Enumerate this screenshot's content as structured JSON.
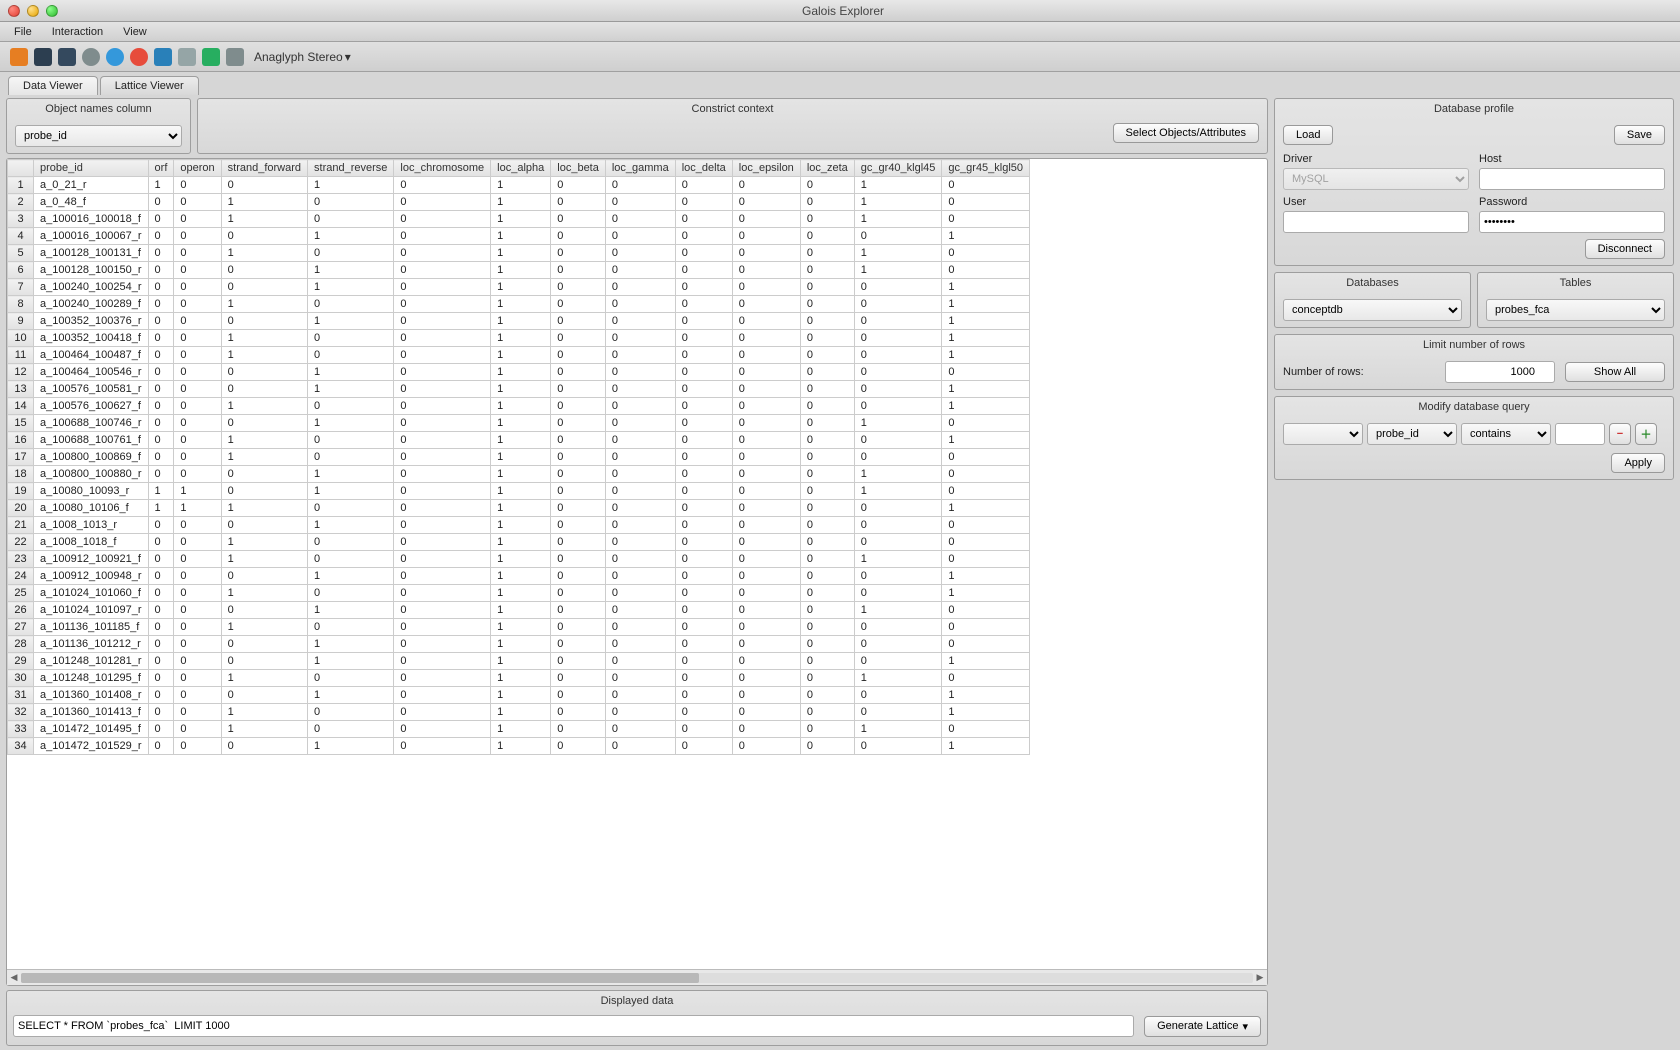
{
  "window": {
    "title": "Galois Explorer"
  },
  "menu": {
    "file": "File",
    "interaction": "Interaction",
    "view": "View"
  },
  "toolbar": {
    "stereo": "Anaglyph Stereo"
  },
  "tabs": {
    "data_viewer": "Data Viewer",
    "lattice_viewer": "Lattice Viewer"
  },
  "obj_col": {
    "header": "Object names column",
    "value": "probe_id"
  },
  "constrict": {
    "header": "Constrict context",
    "select_btn": "Select Objects/Attributes"
  },
  "columns": [
    "probe_id",
    "orf",
    "operon",
    "strand_forward",
    "strand_reverse",
    "loc_chromosome",
    "loc_alpha",
    "loc_beta",
    "loc_gamma",
    "loc_delta",
    "loc_epsilon",
    "loc_zeta",
    "gc_gr40_klgl45",
    "gc_gr45_klgl50"
  ],
  "rows": [
    {
      "n": 1,
      "v": [
        "a_0_21_r",
        "1",
        "0",
        "0",
        "1",
        "0",
        "1",
        "0",
        "0",
        "0",
        "0",
        "0",
        "1",
        "0"
      ]
    },
    {
      "n": 2,
      "v": [
        "a_0_48_f",
        "0",
        "0",
        "1",
        "0",
        "0",
        "1",
        "0",
        "0",
        "0",
        "0",
        "0",
        "1",
        "0"
      ]
    },
    {
      "n": 3,
      "v": [
        "a_100016_100018_f",
        "0",
        "0",
        "1",
        "0",
        "0",
        "1",
        "0",
        "0",
        "0",
        "0",
        "0",
        "1",
        "0"
      ]
    },
    {
      "n": 4,
      "v": [
        "a_100016_100067_r",
        "0",
        "0",
        "0",
        "1",
        "0",
        "1",
        "0",
        "0",
        "0",
        "0",
        "0",
        "0",
        "1"
      ]
    },
    {
      "n": 5,
      "v": [
        "a_100128_100131_f",
        "0",
        "0",
        "1",
        "0",
        "0",
        "1",
        "0",
        "0",
        "0",
        "0",
        "0",
        "1",
        "0"
      ]
    },
    {
      "n": 6,
      "v": [
        "a_100128_100150_r",
        "0",
        "0",
        "0",
        "1",
        "0",
        "1",
        "0",
        "0",
        "0",
        "0",
        "0",
        "1",
        "0"
      ]
    },
    {
      "n": 7,
      "v": [
        "a_100240_100254_r",
        "0",
        "0",
        "0",
        "1",
        "0",
        "1",
        "0",
        "0",
        "0",
        "0",
        "0",
        "0",
        "1"
      ]
    },
    {
      "n": 8,
      "v": [
        "a_100240_100289_f",
        "0",
        "0",
        "1",
        "0",
        "0",
        "1",
        "0",
        "0",
        "0",
        "0",
        "0",
        "0",
        "1"
      ]
    },
    {
      "n": 9,
      "v": [
        "a_100352_100376_r",
        "0",
        "0",
        "0",
        "1",
        "0",
        "1",
        "0",
        "0",
        "0",
        "0",
        "0",
        "0",
        "1"
      ]
    },
    {
      "n": 10,
      "v": [
        "a_100352_100418_f",
        "0",
        "0",
        "1",
        "0",
        "0",
        "1",
        "0",
        "0",
        "0",
        "0",
        "0",
        "0",
        "1"
      ]
    },
    {
      "n": 11,
      "v": [
        "a_100464_100487_f",
        "0",
        "0",
        "1",
        "0",
        "0",
        "1",
        "0",
        "0",
        "0",
        "0",
        "0",
        "0",
        "1"
      ]
    },
    {
      "n": 12,
      "v": [
        "a_100464_100546_r",
        "0",
        "0",
        "0",
        "1",
        "0",
        "1",
        "0",
        "0",
        "0",
        "0",
        "0",
        "0",
        "0"
      ]
    },
    {
      "n": 13,
      "v": [
        "a_100576_100581_r",
        "0",
        "0",
        "0",
        "1",
        "0",
        "1",
        "0",
        "0",
        "0",
        "0",
        "0",
        "0",
        "1"
      ]
    },
    {
      "n": 14,
      "v": [
        "a_100576_100627_f",
        "0",
        "0",
        "1",
        "0",
        "0",
        "1",
        "0",
        "0",
        "0",
        "0",
        "0",
        "0",
        "1"
      ]
    },
    {
      "n": 15,
      "v": [
        "a_100688_100746_r",
        "0",
        "0",
        "0",
        "1",
        "0",
        "1",
        "0",
        "0",
        "0",
        "0",
        "0",
        "1",
        "0"
      ]
    },
    {
      "n": 16,
      "v": [
        "a_100688_100761_f",
        "0",
        "0",
        "1",
        "0",
        "0",
        "1",
        "0",
        "0",
        "0",
        "0",
        "0",
        "0",
        "1"
      ]
    },
    {
      "n": 17,
      "v": [
        "a_100800_100869_f",
        "0",
        "0",
        "1",
        "0",
        "0",
        "1",
        "0",
        "0",
        "0",
        "0",
        "0",
        "0",
        "0"
      ]
    },
    {
      "n": 18,
      "v": [
        "a_100800_100880_r",
        "0",
        "0",
        "0",
        "1",
        "0",
        "1",
        "0",
        "0",
        "0",
        "0",
        "0",
        "1",
        "0"
      ]
    },
    {
      "n": 19,
      "v": [
        "a_10080_10093_r",
        "1",
        "1",
        "0",
        "1",
        "0",
        "1",
        "0",
        "0",
        "0",
        "0",
        "0",
        "1",
        "0"
      ]
    },
    {
      "n": 20,
      "v": [
        "a_10080_10106_f",
        "1",
        "1",
        "1",
        "0",
        "0",
        "1",
        "0",
        "0",
        "0",
        "0",
        "0",
        "0",
        "1"
      ]
    },
    {
      "n": 21,
      "v": [
        "a_1008_1013_r",
        "0",
        "0",
        "0",
        "1",
        "0",
        "1",
        "0",
        "0",
        "0",
        "0",
        "0",
        "0",
        "0"
      ]
    },
    {
      "n": 22,
      "v": [
        "a_1008_1018_f",
        "0",
        "0",
        "1",
        "0",
        "0",
        "1",
        "0",
        "0",
        "0",
        "0",
        "0",
        "0",
        "0"
      ]
    },
    {
      "n": 23,
      "v": [
        "a_100912_100921_f",
        "0",
        "0",
        "1",
        "0",
        "0",
        "1",
        "0",
        "0",
        "0",
        "0",
        "0",
        "1",
        "0"
      ]
    },
    {
      "n": 24,
      "v": [
        "a_100912_100948_r",
        "0",
        "0",
        "0",
        "1",
        "0",
        "1",
        "0",
        "0",
        "0",
        "0",
        "0",
        "0",
        "1"
      ]
    },
    {
      "n": 25,
      "v": [
        "a_101024_101060_f",
        "0",
        "0",
        "1",
        "0",
        "0",
        "1",
        "0",
        "0",
        "0",
        "0",
        "0",
        "0",
        "1"
      ]
    },
    {
      "n": 26,
      "v": [
        "a_101024_101097_r",
        "0",
        "0",
        "0",
        "1",
        "0",
        "1",
        "0",
        "0",
        "0",
        "0",
        "0",
        "1",
        "0"
      ]
    },
    {
      "n": 27,
      "v": [
        "a_101136_101185_f",
        "0",
        "0",
        "1",
        "0",
        "0",
        "1",
        "0",
        "0",
        "0",
        "0",
        "0",
        "0",
        "0"
      ]
    },
    {
      "n": 28,
      "v": [
        "a_101136_101212_r",
        "0",
        "0",
        "0",
        "1",
        "0",
        "1",
        "0",
        "0",
        "0",
        "0",
        "0",
        "0",
        "0"
      ]
    },
    {
      "n": 29,
      "v": [
        "a_101248_101281_r",
        "0",
        "0",
        "0",
        "1",
        "0",
        "1",
        "0",
        "0",
        "0",
        "0",
        "0",
        "0",
        "1"
      ]
    },
    {
      "n": 30,
      "v": [
        "a_101248_101295_f",
        "0",
        "0",
        "1",
        "0",
        "0",
        "1",
        "0",
        "0",
        "0",
        "0",
        "0",
        "1",
        "0"
      ]
    },
    {
      "n": 31,
      "v": [
        "a_101360_101408_r",
        "0",
        "0",
        "0",
        "1",
        "0",
        "1",
        "0",
        "0",
        "0",
        "0",
        "0",
        "0",
        "1"
      ]
    },
    {
      "n": 32,
      "v": [
        "a_101360_101413_f",
        "0",
        "0",
        "1",
        "0",
        "0",
        "1",
        "0",
        "0",
        "0",
        "0",
        "0",
        "0",
        "1"
      ]
    },
    {
      "n": 33,
      "v": [
        "a_101472_101495_f",
        "0",
        "0",
        "1",
        "0",
        "0",
        "1",
        "0",
        "0",
        "0",
        "0",
        "0",
        "1",
        "0"
      ]
    },
    {
      "n": 34,
      "v": [
        "a_101472_101529_r",
        "0",
        "0",
        "0",
        "1",
        "0",
        "1",
        "0",
        "0",
        "0",
        "0",
        "0",
        "0",
        "1"
      ]
    }
  ],
  "displayed": {
    "header": "Displayed data",
    "query": "SELECT * FROM `probes_fca`  LIMIT 1000",
    "gen_btn": "Generate Lattice"
  },
  "db_profile": {
    "header": "Database profile",
    "load": "Load",
    "save": "Save",
    "driver_label": "Driver",
    "driver": "MySQL",
    "host_label": "Host",
    "host": "",
    "user_label": "User",
    "user": "",
    "password_label": "Password",
    "password": "••••••••",
    "disconnect": "Disconnect"
  },
  "db_tables": {
    "databases_label": "Databases",
    "database": "conceptdb",
    "tables_label": "Tables",
    "table": "probes_fca"
  },
  "limit": {
    "header": "Limit number of rows",
    "label": "Number of rows:",
    "value": "1000",
    "show_all": "Show All"
  },
  "modify": {
    "header": "Modify database query",
    "logic": "",
    "field": "probe_id",
    "op": "contains",
    "value": "",
    "apply": "Apply"
  }
}
